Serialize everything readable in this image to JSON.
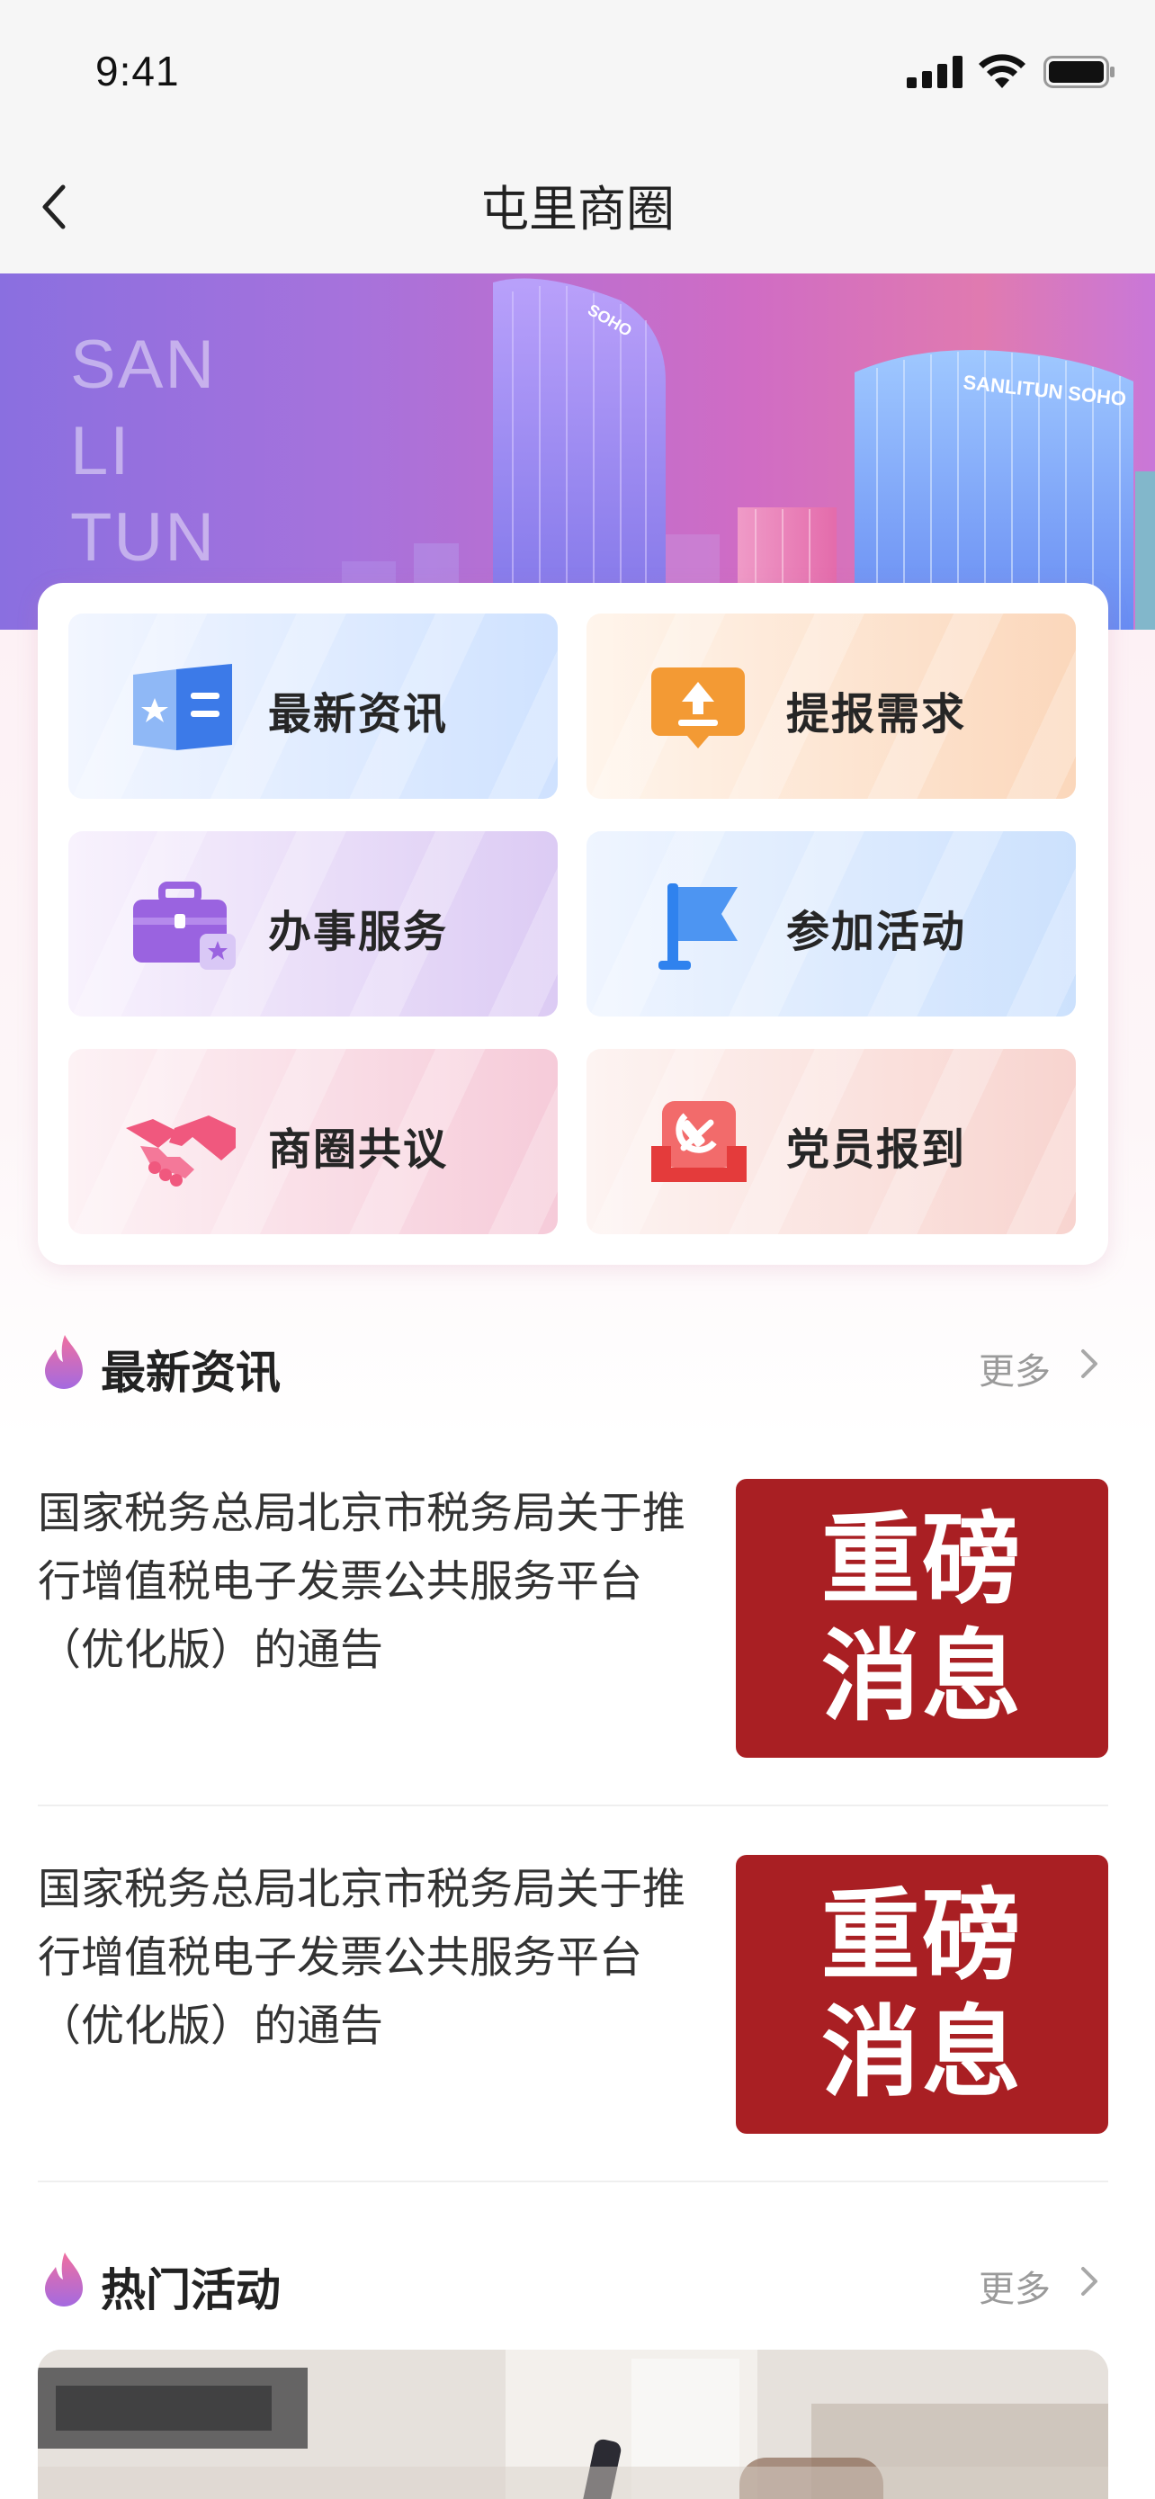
{
  "status_bar": {
    "time": "9:41",
    "icons": [
      "signal-icon",
      "wifi-icon",
      "battery-icon"
    ]
  },
  "nav": {
    "title": "屯里商圈",
    "back_icon": "chevron-left-icon"
  },
  "banner": {
    "words": [
      "SAN",
      "LI",
      "TUN"
    ],
    "building_labels": [
      "SOHO",
      "SANLITUN SOHO"
    ]
  },
  "services": [
    {
      "label": "最新资讯",
      "icon": "news-icon",
      "color": "#4a86ec"
    },
    {
      "label": "提报需求",
      "icon": "upload-icon",
      "color": "#f29a38"
    },
    {
      "label": "办事服务",
      "icon": "briefcase-icon",
      "color": "#9c6bdf"
    },
    {
      "label": "参加活动",
      "icon": "flag-icon",
      "color": "#3f8ff0"
    },
    {
      "label": "商圈共议",
      "icon": "handshake-icon",
      "color": "#f0587e"
    },
    {
      "label": "党员报到",
      "icon": "party-emblem-icon",
      "color": "#e8403c"
    }
  ],
  "news_section": {
    "title": "最新资讯",
    "more": "更多",
    "items": [
      {
        "title": "国家税务总局北京市税务局关于推行增值税电子发票公共服务平台（优化版）的通告",
        "thumb_text": "重磅消息"
      },
      {
        "title": "国家税务总局北京市税务局关于推行增值税电子发票公共服务平台（优化版）的通告",
        "thumb_text": "重磅消息"
      }
    ]
  },
  "activity_section": {
    "title": "热门活动",
    "more": "更多"
  },
  "colors": {
    "thumb_red": "#a91f23",
    "flame_gradient": [
      "#f06fa0",
      "#a46ae0"
    ]
  }
}
